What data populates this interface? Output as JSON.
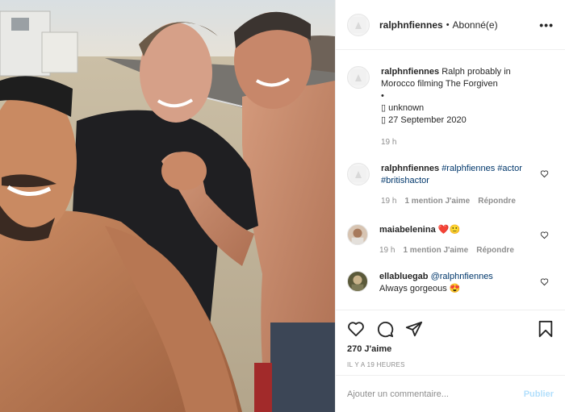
{
  "post": {
    "username": "ralphnfiennes",
    "follow_status": "Abonné(e)",
    "more": "•••",
    "photo_alt": "Selfie of three men outdoors on a desert road"
  },
  "caption": {
    "username": "ralphnfiennes",
    "text": "Ralph probably in Morocco filming The Forgiven",
    "bullet": "•",
    "location": "▯ unknown",
    "date": "▯ 27 September 2020",
    "time": "19 h"
  },
  "comments": [
    {
      "username": "ralphnfiennes",
      "text": "#ralphfiennes #actor #britishactor",
      "time": "19 h",
      "likes": "1 mention J'aime",
      "reply": "Répondre"
    },
    {
      "username": "maiabelenina",
      "text": "❤️🙂",
      "time": "19 h",
      "likes": "1 mention J'aime",
      "reply": "Répondre"
    },
    {
      "username": "ellabluegab",
      "mention": "@ralphnfiennes",
      "text": "Always gorgeous 😍"
    }
  ],
  "stats": {
    "likes": "270 J'aime",
    "ago": "IL Y A 19 HEURES"
  },
  "add_comment": {
    "placeholder": "Ajouter un commentaire...",
    "post": "Publier"
  },
  "colors": {
    "link": "#00376b",
    "muted": "#8e8e8e",
    "post_disabled": "#b2dffc"
  }
}
